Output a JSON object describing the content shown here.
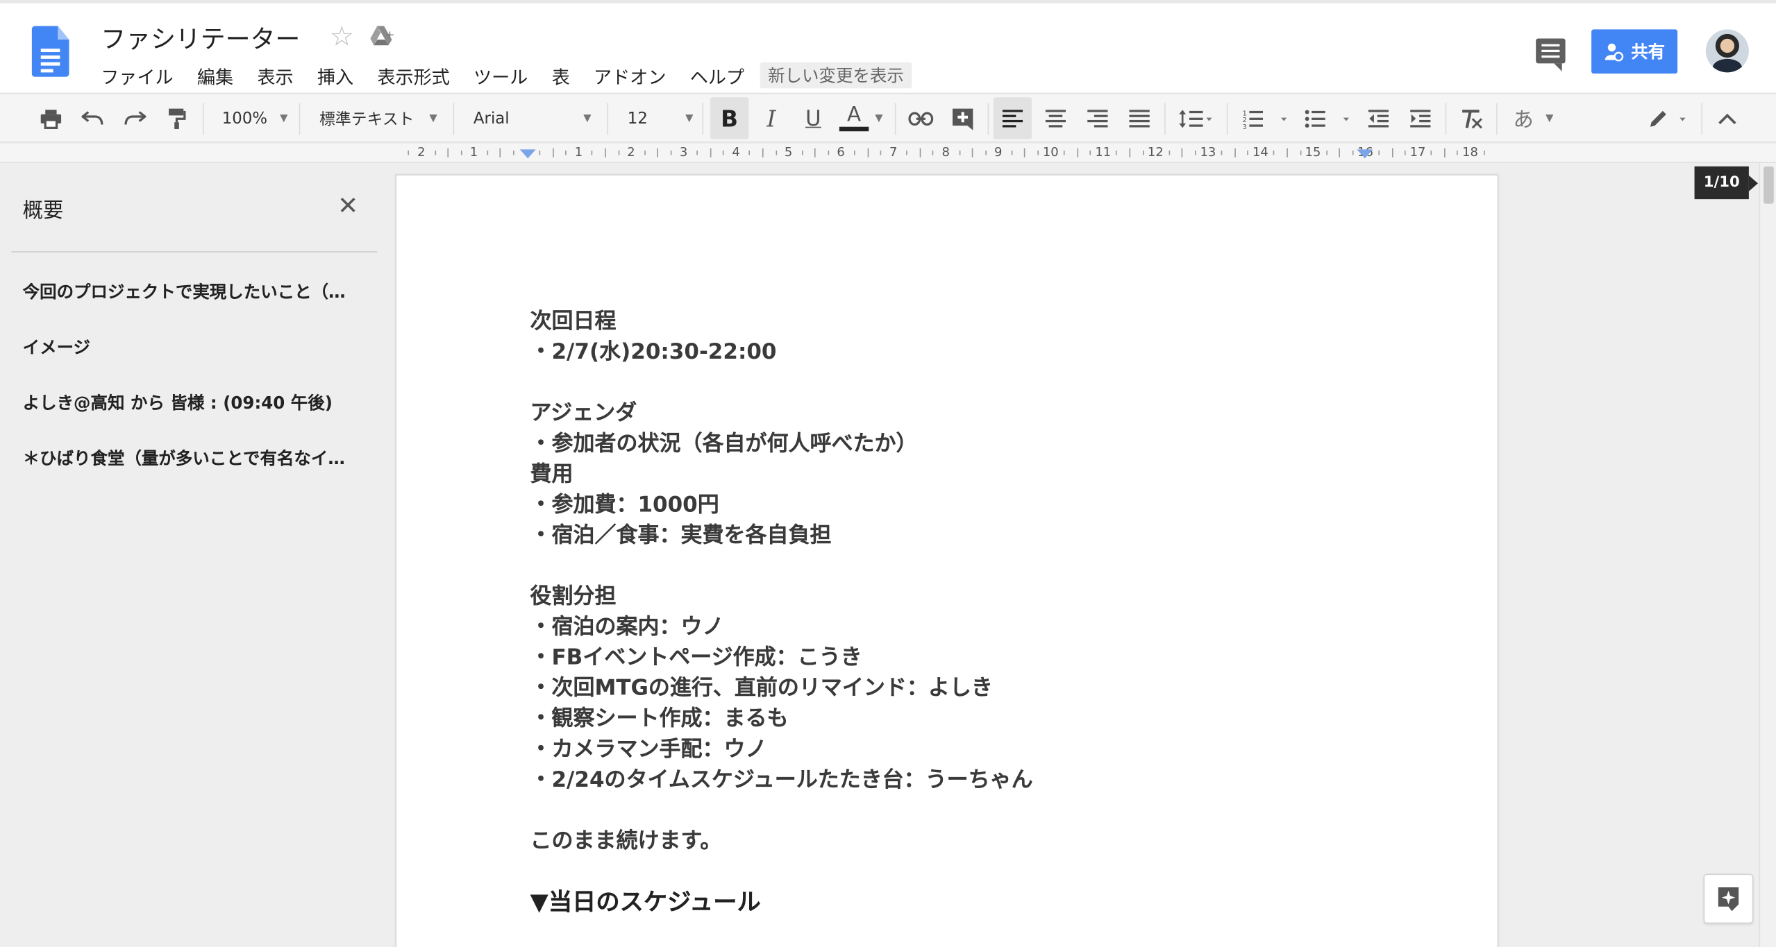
{
  "header": {
    "doc_title": "ファシリテーター",
    "menu": [
      "ファイル",
      "編集",
      "表示",
      "挿入",
      "表示形式",
      "ツール",
      "表",
      "アドオン",
      "ヘルプ"
    ],
    "new_changes": "新しい変更を表示",
    "share_label": "共有"
  },
  "toolbar": {
    "zoom": "100%",
    "style": "標準テキスト",
    "font": "Arial",
    "font_size": "12",
    "bold": "B",
    "italic": "I",
    "underline": "U",
    "text_color": "A",
    "input_tools": "あ"
  },
  "ruler": {
    "labels": [
      "2",
      "1",
      "",
      "1",
      "2",
      "3",
      "4",
      "5",
      "6",
      "7",
      "8",
      "9",
      "10",
      "11",
      "12",
      "13",
      "14",
      "15",
      "16",
      "17",
      "18"
    ]
  },
  "outline": {
    "title": "概要",
    "items": [
      "今回のプロジェクトで実現したいこと（…",
      "イメージ",
      "よしき@高知 から 皆様 : (09:40 午後)",
      "＊ひばり食堂（量が多いことで有名なイ…"
    ]
  },
  "page_badge": "1/10",
  "document": {
    "lines": [
      "次回日程",
      "・2/7(水)20:30-22:00",
      "",
      "アジェンダ",
      "・参加者の状況（各自が何人呼べたか）",
      "費用",
      "・参加費：1000円",
      "・宿泊／食事：実費を各自負担",
      "",
      "役割分担",
      "・宿泊の案内：ウノ",
      "・FBイベントページ作成：こうき",
      "・次回MTGの進行、直前のリマインド：よしき",
      "・観察シート作成：まるも",
      "・カメラマン手配：ウノ",
      "・2/24のタイムスケジュールたたき台：うーちゃん",
      "",
      "このまま続けます。",
      "",
      "▼当日のスケジュール"
    ]
  },
  "colors": {
    "brand_blue": "#4285f4",
    "text_color_bar": "#222222"
  },
  "icons": [
    "docs-logo-icon",
    "star-icon",
    "drive-icon",
    "comment-icon",
    "share-person-icon",
    "print-icon",
    "undo-icon",
    "redo-icon",
    "paint-format-icon",
    "link-icon",
    "insert-comment-icon",
    "align-left-icon",
    "align-center-icon",
    "align-right-icon",
    "justify-icon",
    "line-spacing-icon",
    "numbered-list-icon",
    "bulleted-list-icon",
    "decrease-indent-icon",
    "increase-indent-icon",
    "clear-formatting-icon",
    "pencil-icon",
    "collapse-icon",
    "close-icon",
    "explore-icon"
  ]
}
